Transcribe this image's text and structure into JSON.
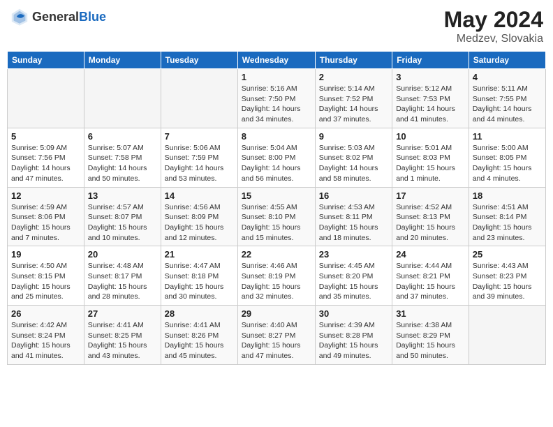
{
  "header": {
    "logo_general": "General",
    "logo_blue": "Blue",
    "title": "May 2024",
    "location": "Medzev, Slovakia"
  },
  "days_of_week": [
    "Sunday",
    "Monday",
    "Tuesday",
    "Wednesday",
    "Thursday",
    "Friday",
    "Saturday"
  ],
  "weeks": [
    [
      {
        "day": "",
        "info": ""
      },
      {
        "day": "",
        "info": ""
      },
      {
        "day": "",
        "info": ""
      },
      {
        "day": "1",
        "info": "Sunrise: 5:16 AM\nSunset: 7:50 PM\nDaylight: 14 hours and 34 minutes."
      },
      {
        "day": "2",
        "info": "Sunrise: 5:14 AM\nSunset: 7:52 PM\nDaylight: 14 hours and 37 minutes."
      },
      {
        "day": "3",
        "info": "Sunrise: 5:12 AM\nSunset: 7:53 PM\nDaylight: 14 hours and 41 minutes."
      },
      {
        "day": "4",
        "info": "Sunrise: 5:11 AM\nSunset: 7:55 PM\nDaylight: 14 hours and 44 minutes."
      }
    ],
    [
      {
        "day": "5",
        "info": "Sunrise: 5:09 AM\nSunset: 7:56 PM\nDaylight: 14 hours and 47 minutes."
      },
      {
        "day": "6",
        "info": "Sunrise: 5:07 AM\nSunset: 7:58 PM\nDaylight: 14 hours and 50 minutes."
      },
      {
        "day": "7",
        "info": "Sunrise: 5:06 AM\nSunset: 7:59 PM\nDaylight: 14 hours and 53 minutes."
      },
      {
        "day": "8",
        "info": "Sunrise: 5:04 AM\nSunset: 8:00 PM\nDaylight: 14 hours and 56 minutes."
      },
      {
        "day": "9",
        "info": "Sunrise: 5:03 AM\nSunset: 8:02 PM\nDaylight: 14 hours and 58 minutes."
      },
      {
        "day": "10",
        "info": "Sunrise: 5:01 AM\nSunset: 8:03 PM\nDaylight: 15 hours and 1 minute."
      },
      {
        "day": "11",
        "info": "Sunrise: 5:00 AM\nSunset: 8:05 PM\nDaylight: 15 hours and 4 minutes."
      }
    ],
    [
      {
        "day": "12",
        "info": "Sunrise: 4:59 AM\nSunset: 8:06 PM\nDaylight: 15 hours and 7 minutes."
      },
      {
        "day": "13",
        "info": "Sunrise: 4:57 AM\nSunset: 8:07 PM\nDaylight: 15 hours and 10 minutes."
      },
      {
        "day": "14",
        "info": "Sunrise: 4:56 AM\nSunset: 8:09 PM\nDaylight: 15 hours and 12 minutes."
      },
      {
        "day": "15",
        "info": "Sunrise: 4:55 AM\nSunset: 8:10 PM\nDaylight: 15 hours and 15 minutes."
      },
      {
        "day": "16",
        "info": "Sunrise: 4:53 AM\nSunset: 8:11 PM\nDaylight: 15 hours and 18 minutes."
      },
      {
        "day": "17",
        "info": "Sunrise: 4:52 AM\nSunset: 8:13 PM\nDaylight: 15 hours and 20 minutes."
      },
      {
        "day": "18",
        "info": "Sunrise: 4:51 AM\nSunset: 8:14 PM\nDaylight: 15 hours and 23 minutes."
      }
    ],
    [
      {
        "day": "19",
        "info": "Sunrise: 4:50 AM\nSunset: 8:15 PM\nDaylight: 15 hours and 25 minutes."
      },
      {
        "day": "20",
        "info": "Sunrise: 4:48 AM\nSunset: 8:17 PM\nDaylight: 15 hours and 28 minutes."
      },
      {
        "day": "21",
        "info": "Sunrise: 4:47 AM\nSunset: 8:18 PM\nDaylight: 15 hours and 30 minutes."
      },
      {
        "day": "22",
        "info": "Sunrise: 4:46 AM\nSunset: 8:19 PM\nDaylight: 15 hours and 32 minutes."
      },
      {
        "day": "23",
        "info": "Sunrise: 4:45 AM\nSunset: 8:20 PM\nDaylight: 15 hours and 35 minutes."
      },
      {
        "day": "24",
        "info": "Sunrise: 4:44 AM\nSunset: 8:21 PM\nDaylight: 15 hours and 37 minutes."
      },
      {
        "day": "25",
        "info": "Sunrise: 4:43 AM\nSunset: 8:23 PM\nDaylight: 15 hours and 39 minutes."
      }
    ],
    [
      {
        "day": "26",
        "info": "Sunrise: 4:42 AM\nSunset: 8:24 PM\nDaylight: 15 hours and 41 minutes."
      },
      {
        "day": "27",
        "info": "Sunrise: 4:41 AM\nSunset: 8:25 PM\nDaylight: 15 hours and 43 minutes."
      },
      {
        "day": "28",
        "info": "Sunrise: 4:41 AM\nSunset: 8:26 PM\nDaylight: 15 hours and 45 minutes."
      },
      {
        "day": "29",
        "info": "Sunrise: 4:40 AM\nSunset: 8:27 PM\nDaylight: 15 hours and 47 minutes."
      },
      {
        "day": "30",
        "info": "Sunrise: 4:39 AM\nSunset: 8:28 PM\nDaylight: 15 hours and 49 minutes."
      },
      {
        "day": "31",
        "info": "Sunrise: 4:38 AM\nSunset: 8:29 PM\nDaylight: 15 hours and 50 minutes."
      },
      {
        "day": "",
        "info": ""
      }
    ]
  ]
}
